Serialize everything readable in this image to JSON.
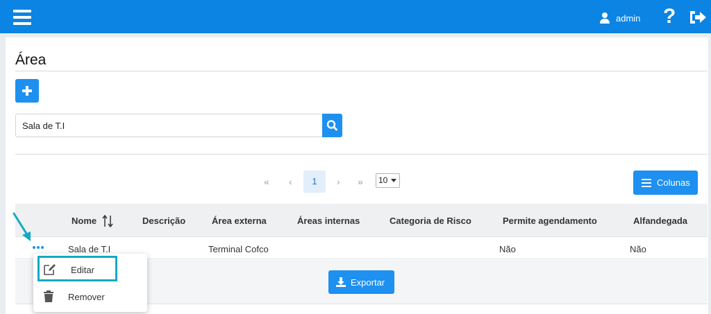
{
  "header": {
    "user_name": "admin",
    "help_glyph": "?"
  },
  "page": {
    "title": "Área"
  },
  "search": {
    "value": "Sala de T.I"
  },
  "pagination": {
    "first": "«",
    "prev": "‹",
    "current": "1",
    "next": "›",
    "last": "»",
    "page_size": "10"
  },
  "columns_button": "Colunas",
  "table": {
    "headers": [
      "Nome",
      "Descrição",
      "Área externa",
      "Áreas internas",
      "Categoria de Risco",
      "Permite agendamento",
      "Alfandegada"
    ],
    "rows": [
      {
        "nome": "Sala de T.I",
        "descricao": "",
        "area_externa": "Terminal Cofco",
        "areas_internas": "",
        "categoria_risco": "",
        "permite_agendamento": "Não",
        "alfandegada": "Não"
      }
    ]
  },
  "export_button": "Exportar",
  "row_menu": {
    "edit": "Editar",
    "remove": "Remover"
  },
  "colors": {
    "primary": "#1e90f0",
    "topbar": "#0b84e3",
    "highlight": "#14a8c4"
  }
}
